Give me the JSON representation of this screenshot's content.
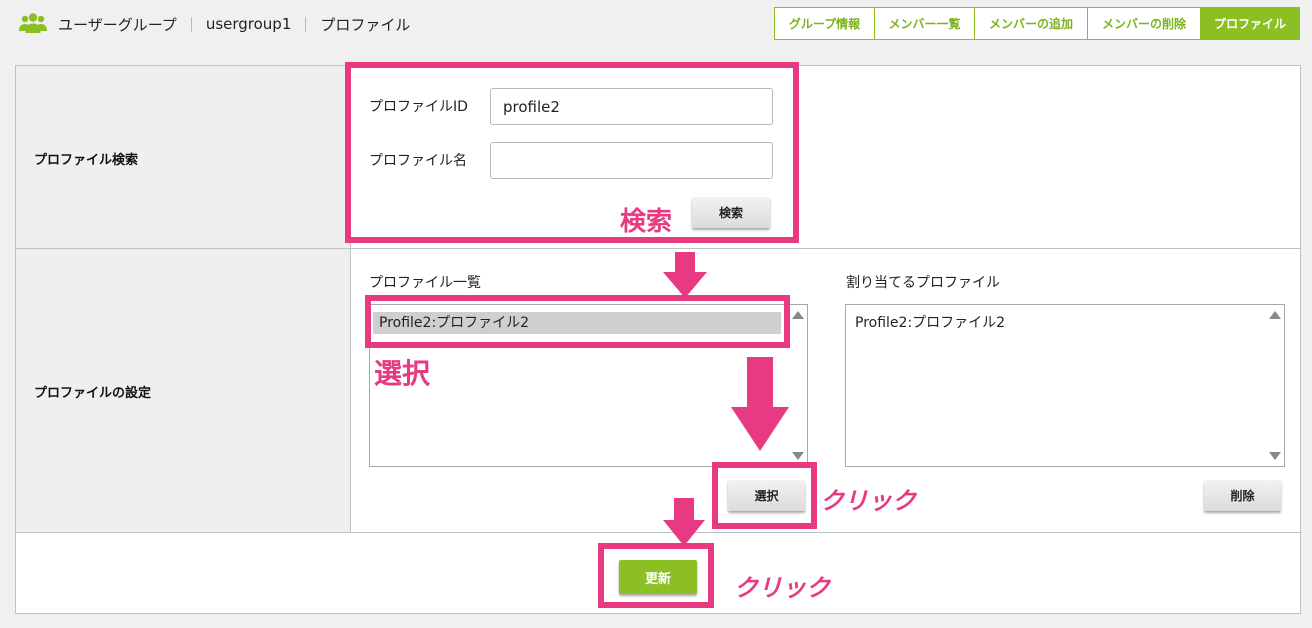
{
  "header": {
    "section_title": "ユーザーグループ",
    "group_id": "usergroup1",
    "page_title": "プロファイル"
  },
  "tabs": [
    {
      "label": "グループ情報",
      "active": false
    },
    {
      "label": "メンバー一覧",
      "active": false
    },
    {
      "label": "メンバーの追加",
      "active": false
    },
    {
      "label": "メンバーの削除",
      "active": false
    },
    {
      "label": "プロファイル",
      "active": true
    }
  ],
  "search": {
    "row_label": "プロファイル検索",
    "profile_id_label": "プロファイルID",
    "profile_id_value": "profile2",
    "profile_name_label": "プロファイル名",
    "profile_name_value": "",
    "search_button": "検索"
  },
  "settings": {
    "row_label": "プロファイルの設定",
    "list_label": "プロファイル一覧",
    "list_items": [
      {
        "label": "Profile2:プロファイル2",
        "selected": true
      }
    ],
    "assigned_label": "割り当てるプロファイル",
    "assigned_items": [
      {
        "label": "Profile2:プロファイル2",
        "selected": false
      }
    ],
    "select_button": "選択",
    "delete_button": "削除"
  },
  "footer": {
    "update_button": "更新"
  },
  "annotations": {
    "search_note": "検索",
    "select_note": "選択",
    "click_note_1": "クリック",
    "click_note_2": "クリック",
    "highlight_color": "#e83a82"
  },
  "colors": {
    "accent_green": "#8bbf24",
    "label_bg": "#efefef"
  }
}
